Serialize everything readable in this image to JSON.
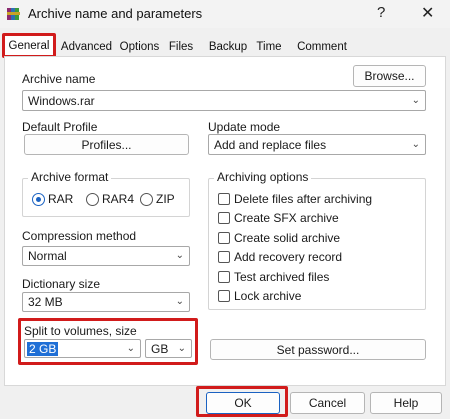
{
  "window": {
    "title": "Archive name and parameters",
    "help_glyph": "?",
    "close_glyph": "✕"
  },
  "tabs": [
    {
      "label": "General",
      "active": true
    },
    {
      "label": "Advanced"
    },
    {
      "label": "Options"
    },
    {
      "label": "Files"
    },
    {
      "label": "Backup"
    },
    {
      "label": "Time"
    },
    {
      "label": "Comment"
    }
  ],
  "archive_name": {
    "label": "Archive name",
    "value": "Windows.rar",
    "browse_label": "Browse..."
  },
  "default_profile": {
    "label": "Default Profile",
    "button_label": "Profiles..."
  },
  "update_mode": {
    "label": "Update mode",
    "value": "Add and replace files"
  },
  "archive_format": {
    "title": "Archive format",
    "options": [
      {
        "label": "RAR",
        "selected": true
      },
      {
        "label": "RAR4",
        "selected": false
      },
      {
        "label": "ZIP",
        "selected": false
      }
    ]
  },
  "compression_method": {
    "label": "Compression method",
    "value": "Normal"
  },
  "dictionary_size": {
    "label": "Dictionary size",
    "value": "32 MB"
  },
  "split_volumes": {
    "label": "Split to volumes, size",
    "value": "2 GB",
    "unit": "GB"
  },
  "archiving_options": {
    "title": "Archiving options",
    "items": [
      {
        "label": "Delete files after archiving",
        "checked": false
      },
      {
        "label": "Create SFX archive",
        "checked": false
      },
      {
        "label": "Create solid archive",
        "checked": false
      },
      {
        "label": "Add recovery record",
        "checked": false
      },
      {
        "label": "Test archived files",
        "checked": false
      },
      {
        "label": "Lock archive",
        "checked": false
      }
    ]
  },
  "set_password_label": "Set password...",
  "footer": {
    "ok_label": "OK",
    "cancel_label": "Cancel",
    "help_label": "Help"
  },
  "colors": {
    "highlight": "#d11b1b",
    "selection": "#1f6fd6",
    "radio_accent": "#1a62c2"
  },
  "icons": {
    "app": "winrar-books-icon",
    "dropdown": "chevron-down-icon"
  }
}
